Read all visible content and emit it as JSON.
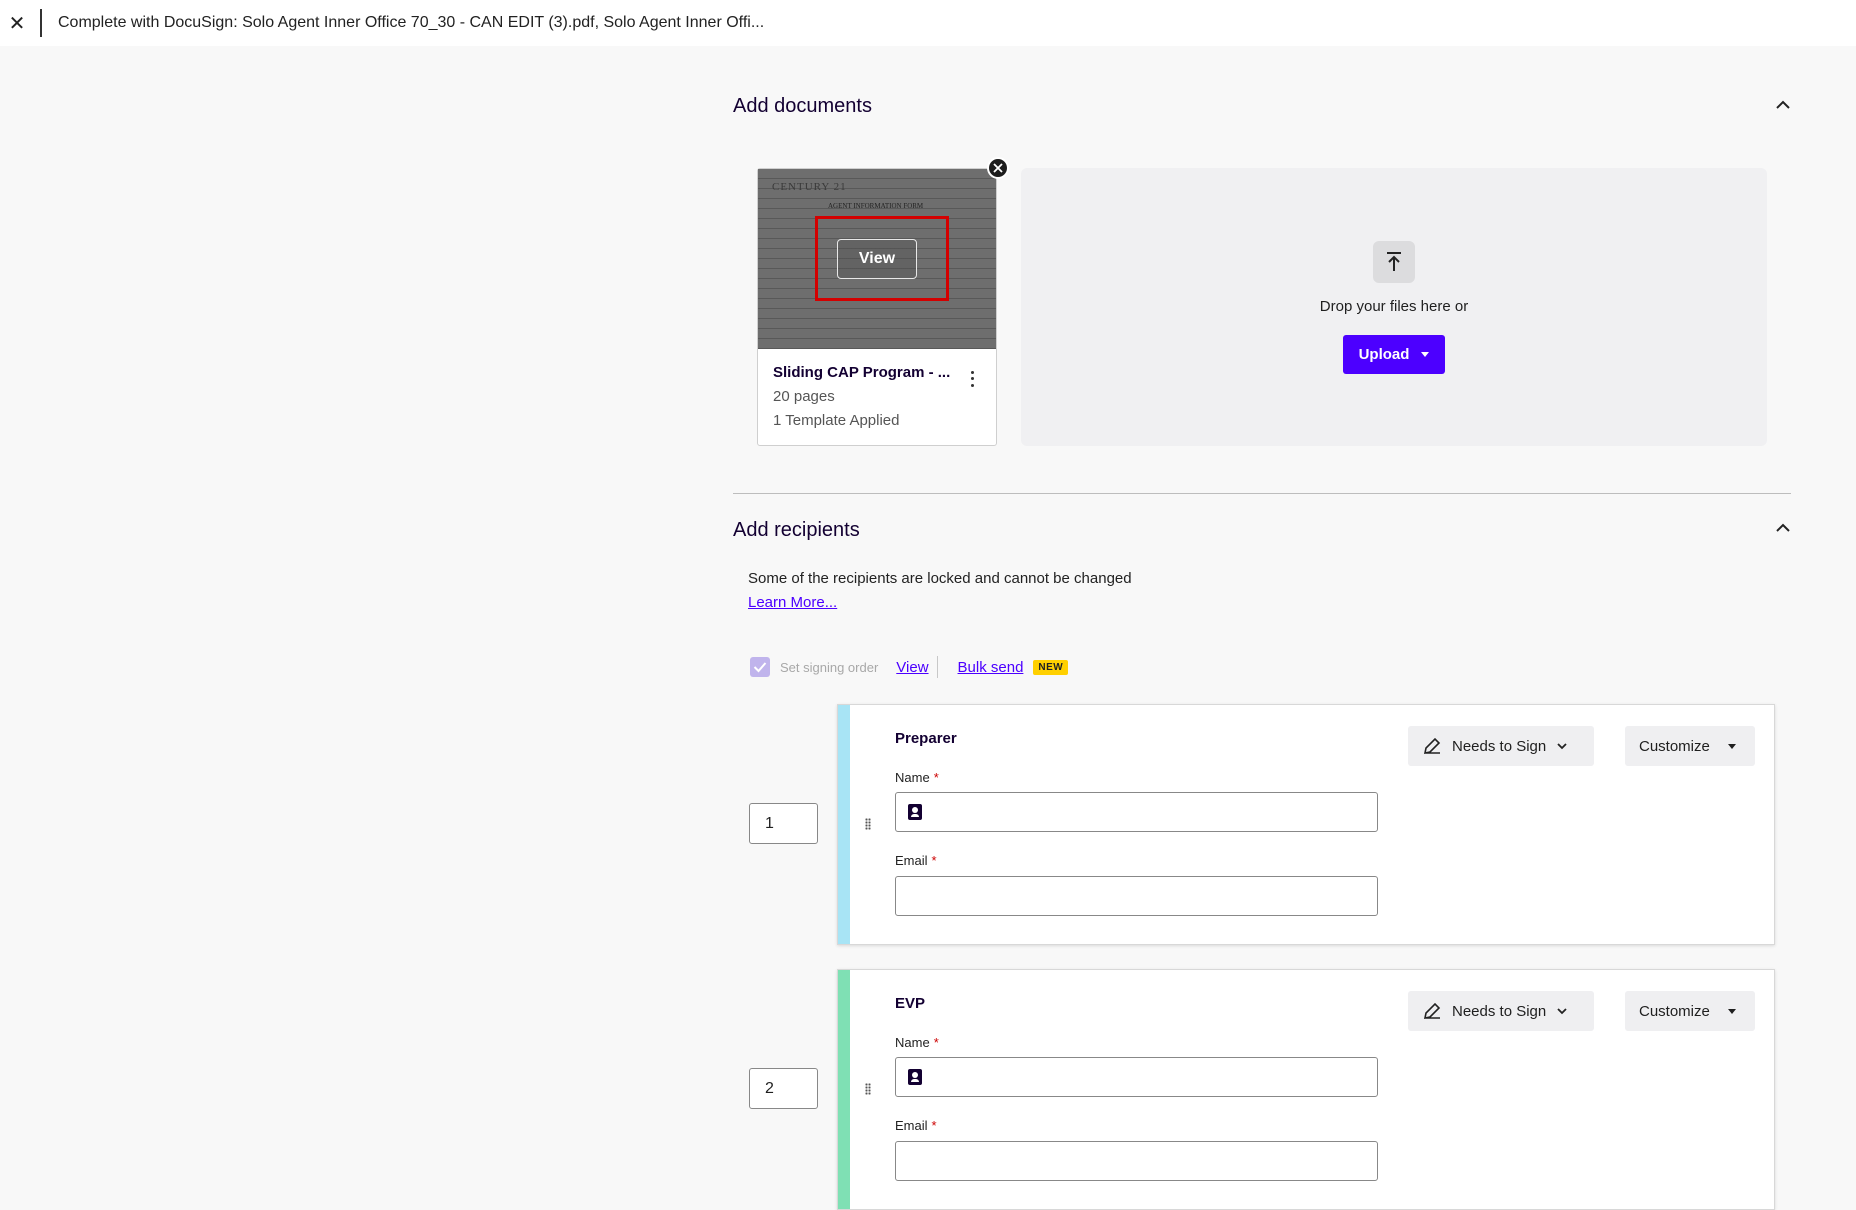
{
  "topbar": {
    "close_glyph": "✕",
    "title": "Complete with DocuSign: Solo Agent Inner Office 70_30 - CAN EDIT (3).pdf, Solo Agent Inner Offi..."
  },
  "documents": {
    "section_title": "Add documents",
    "doc": {
      "thumb_brand": "CENTURY 21",
      "thumb_form_title": "AGENT INFORMATION FORM",
      "view_label": "View",
      "name": "Sliding CAP Program - ...",
      "pages": "20 pages",
      "templates": "1 Template Applied"
    },
    "dropzone": {
      "text": "Drop your files here or",
      "upload_label": "Upload"
    }
  },
  "recipients": {
    "section_title": "Add recipients",
    "locked_text": "Some of the recipients are locked and cannot be changed",
    "learn_more": "Learn More...",
    "signing_order_label": "Set signing order",
    "signing_order_checked": true,
    "view_label": "View",
    "bulk_send_label": "Bulk send",
    "new_badge": "NEW",
    "list": [
      {
        "order": "1",
        "role": "Preparer",
        "stripe_color": "#a8e4f5",
        "name_label": "Name",
        "email_label": "Email",
        "required_mark": "*",
        "name_value": "",
        "email_value": "",
        "action_label": "Needs to Sign",
        "customize_label": "Customize"
      },
      {
        "order": "2",
        "role": "EVP",
        "stripe_color": "#7fe0b4",
        "name_label": "Name",
        "email_label": "Email",
        "required_mark": "*",
        "name_value": "",
        "email_value": "",
        "action_label": "Needs to Sign",
        "customize_label": "Customize"
      }
    ]
  },
  "colors": {
    "accent": "#4c00ff",
    "heading": "#130032",
    "badge": "#ffd000"
  }
}
